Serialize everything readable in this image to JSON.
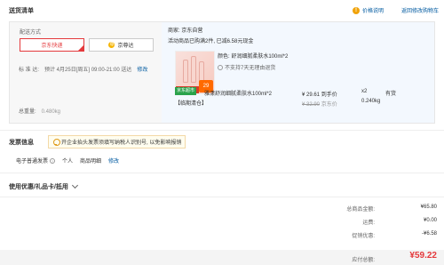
{
  "header": {
    "title": "送货清单",
    "price_help": "价格说明",
    "back_to_cart": "返回修改购物车"
  },
  "shipping": {
    "label": "配送方式",
    "option_jd": "京东快递",
    "option_arrive": "京尊达",
    "arrive_icon": "尊",
    "std_label": "标  准  达:",
    "std_time": "预计 4月25日[周五] 09:00-21:00 送达",
    "std_edit": "修改",
    "weight_label": "总重量:",
    "weight_value": "0.480kg"
  },
  "seller": {
    "label": "商家: 京东自营",
    "promo": "活动商品已购满2件, 已减6.58元现金"
  },
  "product": {
    "color_label": "颜色: 舒润细腻柔肤水100ml*2",
    "support": "不支持7天无理由退货",
    "market_badge": "京东超市",
    "tag_price": "29",
    "name": "雅漾舒润细腻柔肤水100ml*2",
    "clearance": "【临期清仓】",
    "price": "¥ 29.61",
    "price_suffix": "到手价",
    "orig_price": "¥ 32.90",
    "orig_suffix": "京东价",
    "qty": "x2",
    "weight": "0.240kg",
    "stock": "有货"
  },
  "invoice": {
    "title": "发票信息",
    "tip": "开企业抬头发票须填写纳税人识别号, 以免影响报销",
    "type": "电子普通发票",
    "personal": "个人",
    "content": "商品明细",
    "edit": "修改"
  },
  "coupon": {
    "title": "使用优惠/礼品卡/抵用"
  },
  "summary": {
    "total_label": "总商品金额:",
    "total_value": "¥65.80",
    "freight_label": "运费:",
    "freight_value": "¥0.00",
    "discount_label": "促销优惠:",
    "discount_value": "-¥6.58",
    "pay_label": "应付总额:",
    "pay_value": "¥59.22"
  },
  "colors": {
    "accent_red": "#e4393c",
    "link_blue": "#005aa0",
    "market_green": "#2ba34c"
  }
}
